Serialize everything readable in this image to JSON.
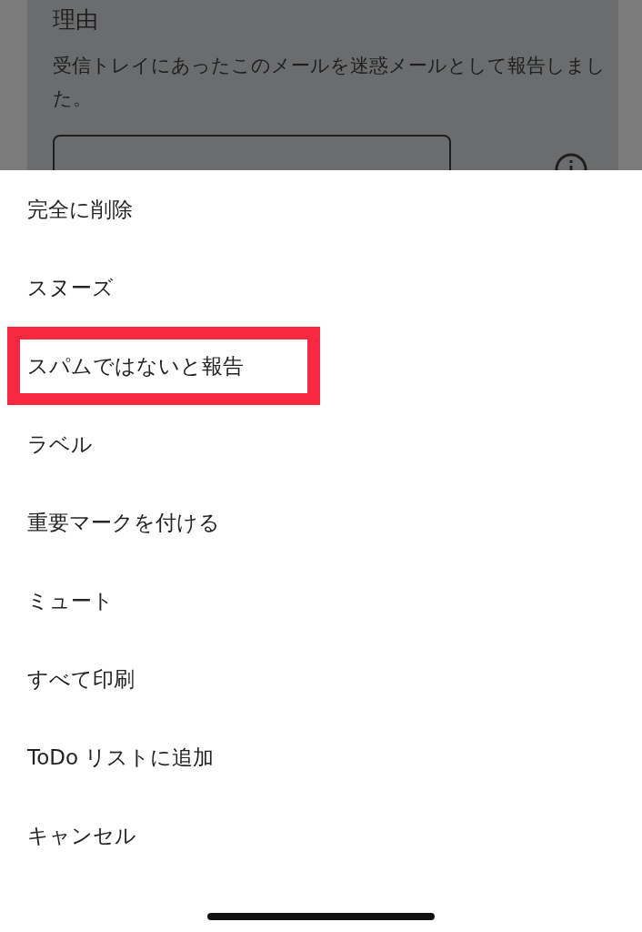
{
  "background_page": {
    "heading": "理由",
    "description": "受信トレイにあったこのメールを迷惑メールとして報告しました。"
  },
  "action_sheet": {
    "items": [
      {
        "label": "完全に削除",
        "highlighted": false
      },
      {
        "label": "スヌーズ",
        "highlighted": false
      },
      {
        "label": "スパムではないと報告",
        "highlighted": true
      },
      {
        "label": "ラベル",
        "highlighted": false
      },
      {
        "label": "重要マークを付ける",
        "highlighted": false
      },
      {
        "label": "ミュート",
        "highlighted": false
      },
      {
        "label": "すべて印刷",
        "highlighted": false
      },
      {
        "label": "ToDo リストに追加",
        "highlighted": false
      },
      {
        "label": "キャンセル",
        "highlighted": false
      }
    ]
  }
}
